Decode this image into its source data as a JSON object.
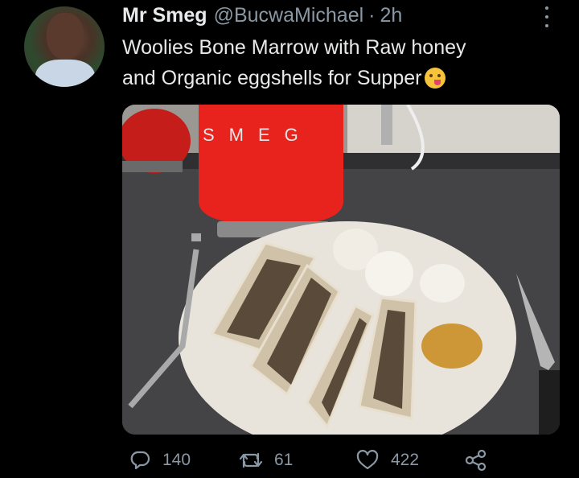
{
  "tweet": {
    "author_name": "Mr Smeg",
    "handle": "@BucwaMichael",
    "separator": "·",
    "time": "2h",
    "text_line1": "Woolies Bone Marrow with Raw honey",
    "text_line2": "and Organic eggshells for Supper",
    "emoji": "face-savoring-food-emoji",
    "photo_kettle_logo": "SMEG"
  },
  "actions": {
    "replies": "140",
    "retweets": "61",
    "likes": "422"
  },
  "icons": {
    "reply": "reply-icon",
    "retweet": "retweet-icon",
    "like": "heart-icon",
    "share": "share-icon",
    "more": "more-options-icon"
  },
  "colors": {
    "background": "#000000",
    "text": "#e7e9ea",
    "secondary": "#8b98a5",
    "kettle_red": "#e8231e"
  }
}
